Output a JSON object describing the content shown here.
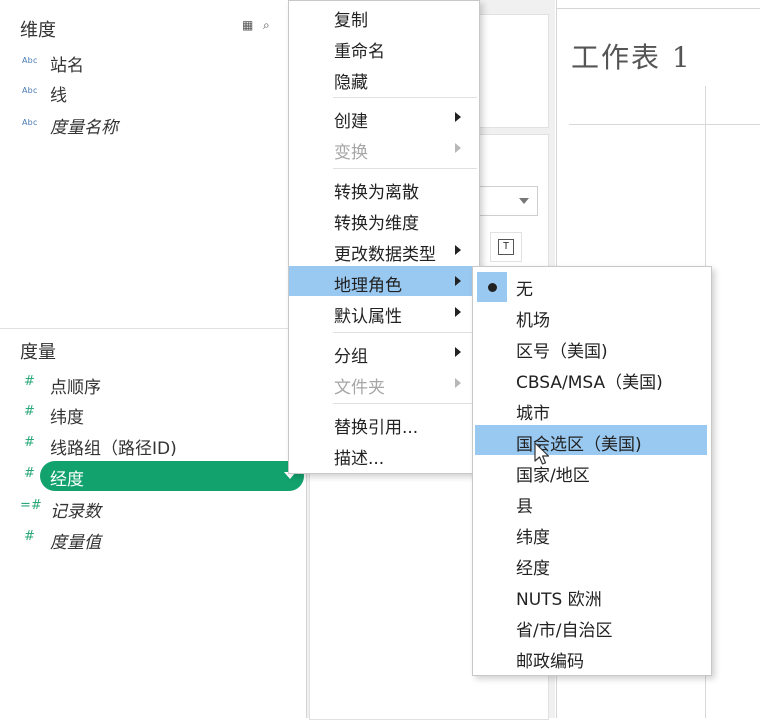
{
  "dimensions": {
    "title": "维度",
    "fields": [
      {
        "type_icon": "Abc",
        "label": "站名"
      },
      {
        "type_icon": "Abc",
        "label": "线"
      },
      {
        "type_icon": "Abc",
        "label": "度量名称"
      }
    ]
  },
  "measures": {
    "title": "度量",
    "fields": [
      {
        "type_icon": "#",
        "label": "点顺序"
      },
      {
        "type_icon": "#",
        "label": "纬度"
      },
      {
        "type_icon": "#",
        "label": "线路组（路径ID)"
      },
      {
        "type_icon": "#",
        "label": "经度"
      },
      {
        "type_icon": "=#",
        "label": "记录数"
      },
      {
        "type_icon": "#",
        "label": "度量值"
      }
    ]
  },
  "sheet": {
    "title": "工作表 1"
  },
  "context_menu": {
    "items": [
      {
        "label": "复制"
      },
      {
        "label": "重命名"
      },
      {
        "label": "隐藏"
      },
      {
        "label": "创建"
      },
      {
        "label": "变换"
      },
      {
        "label": "转换为离散"
      },
      {
        "label": "转换为维度"
      },
      {
        "label": "更改数据类型"
      },
      {
        "label": "地理角色"
      },
      {
        "label": "默认属性"
      },
      {
        "label": "分组"
      },
      {
        "label": "文件夹"
      },
      {
        "label": "替换引用..."
      },
      {
        "label": "描述..."
      }
    ]
  },
  "geo_submenu": {
    "items": [
      {
        "label": "无"
      },
      {
        "label": "机场"
      },
      {
        "label": "区号（美国)"
      },
      {
        "label": "CBSA/MSA（美国)"
      },
      {
        "label": "城市"
      },
      {
        "label": "国会选区（美国)"
      },
      {
        "label": "国家/地区"
      },
      {
        "label": "县"
      },
      {
        "label": "纬度"
      },
      {
        "label": "经度"
      },
      {
        "label": "NUTS 欧洲"
      },
      {
        "label": "省/市/自治区"
      },
      {
        "label": "邮政编码"
      }
    ]
  },
  "colors": {
    "selected_pill": "#12a26e",
    "menu_highlight": "#99c8f0",
    "measure_icon": "#2aa87a",
    "dimension_icon": "#4a7cb4"
  }
}
